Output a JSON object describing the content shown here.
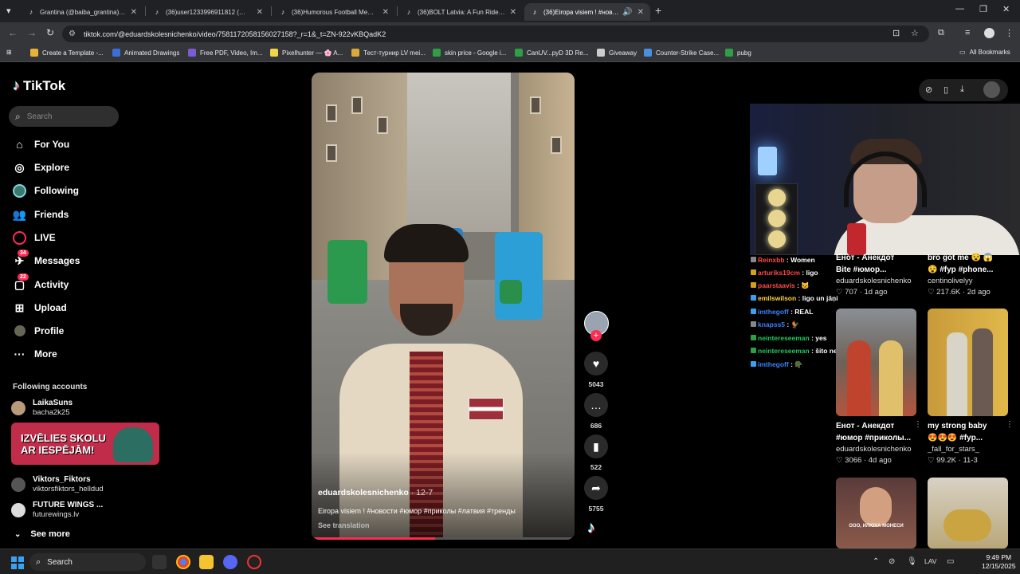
{
  "browser": {
    "tabs": [
      {
        "title": "Grantina (@baiba_grantina) | TikTok",
        "active": false
      },
      {
        "title": "(36)user1233996911812 (@and",
        "active": false
      },
      {
        "title": "(36)Humorous Football Memes",
        "active": false
      },
      {
        "title": "(36)BOLT Latvia: A Fun Ride Exp",
        "active": false
      },
      {
        "title": "(36)Eiropa visiem ! #новост",
        "active": true
      }
    ],
    "url": "tiktok.com/@eduardskolesnichenko/video/7581172058156027158?_r=1&_t=ZN-922vKBQadK2",
    "bookmarks": [
      {
        "label": "Create a Template -...",
        "color": "#e8b23a"
      },
      {
        "label": "Animated Drawings",
        "color": "#3b6fd8"
      },
      {
        "label": "Free PDF, Video, Im...",
        "color": "#7a5cd6"
      },
      {
        "label": "Pixelhunter — 🌸 A...",
        "color": "#f2d34c"
      },
      {
        "label": "Тест-турнир LV mei...",
        "color": "#d9a93a"
      },
      {
        "label": "skin price - Google i...",
        "color": "#2f9e44"
      },
      {
        "label": "CanUV...pyD 3D Re...",
        "color": "#2f9e44"
      },
      {
        "label": "Giveaway",
        "color": "#cccccc"
      },
      {
        "label": "Counter-Strike Case...",
        "color": "#4a8fe0"
      },
      {
        "label": "pubg",
        "color": "#2f9e44"
      }
    ],
    "all_bookmarks": "All Bookmarks"
  },
  "sidebar": {
    "logo": "TikTok",
    "search_placeholder": "Search",
    "nav": [
      {
        "label": "For You",
        "icon": "home-icon"
      },
      {
        "label": "Explore",
        "icon": "compass-icon"
      },
      {
        "label": "Following",
        "icon": "following-icon"
      },
      {
        "label": "Friends",
        "icon": "friends-icon"
      },
      {
        "label": "LIVE",
        "icon": "live-icon"
      },
      {
        "label": "Messages",
        "icon": "messages-icon",
        "badge": "34"
      },
      {
        "label": "Activity",
        "icon": "activity-icon",
        "badge": "22"
      },
      {
        "label": "Upload",
        "icon": "upload-icon"
      },
      {
        "label": "Profile",
        "icon": "profile-icon"
      },
      {
        "label": "More",
        "icon": "more-icon"
      }
    ],
    "following_title": "Following accounts",
    "accounts": [
      {
        "name": "LaikaSuns",
        "handle": "bacha2k25"
      },
      {
        "name": "Viktors_Fiktors",
        "handle": "viktorsfiktors_helldud"
      },
      {
        "name": "FUTURE WINGS ...",
        "handle": "futurewings.lv"
      }
    ],
    "promo": {
      "line1": "IZVĒLIES SKOLU",
      "line2": "AR IESPĒJĀM!"
    },
    "see_more": "See more"
  },
  "video": {
    "author": "eduardskolesnichenko",
    "date": "12-7",
    "caption": "Eiropa visiem ! #новости #юмор #приколы #латвия #тренды",
    "see_translation": "See translation",
    "progress": 0.47,
    "likes": "5043",
    "comments": "686",
    "saves": "522",
    "shares": "5755"
  },
  "chat": [
    {
      "user": "Reinxbb",
      "msg": "Women",
      "color": "#ff4a4a"
    },
    {
      "user": "arturiks19cm",
      "msg": "ligo",
      "color": "#ff4a4a"
    },
    {
      "user": "paarstaavis",
      "msg": "🐱",
      "color": "#ff4a4a"
    },
    {
      "user": "emilswilson",
      "msg": "ligo un jāņi",
      "color": "#ffd23f"
    },
    {
      "user": "imthegoff",
      "msg": "REAL",
      "color": "#3b82f6"
    },
    {
      "user": "knapss5",
      "msg": "🐓",
      "color": "#3b82f6"
    },
    {
      "user": "neintereseeman",
      "msg": "yes",
      "color": "#22c55e"
    },
    {
      "user": "neintereseeman",
      "msg": "šito ne",
      "color": "#22c55e"
    },
    {
      "user": "imthegoff",
      "msg": "🪖",
      "color": "#3b82f6"
    }
  ],
  "related": [
    {
      "title": "Енот - Анекдот",
      "title2": "Bite #юмор...",
      "author": "eduardskolesnichenko",
      "likes": "707",
      "age": "1d ago"
    },
    {
      "title": "bro got me 😵 😱",
      "title2": "😵 #fyp #phone...",
      "author": "centinolivelyy",
      "likes": "217.6K",
      "age": "2d ago"
    },
    {
      "title": "Енот - Анекдот",
      "title2": "#юмор #приколы...",
      "author": "eduardskolesnichenko",
      "likes": "3066",
      "age": "4d ago"
    },
    {
      "title": "my strong baby",
      "title2": "😍😍😍 #fyp...",
      "author": "_fall_for_stars_",
      "likes": "99.2K",
      "age": "11-3"
    }
  ],
  "thumb5_caption": "ООО, ИЛЮХА МОНЕСИ",
  "taskbar": {
    "search": "Search",
    "lang": "LAV",
    "time": "9:49 PM",
    "date": "12/15/2025"
  }
}
